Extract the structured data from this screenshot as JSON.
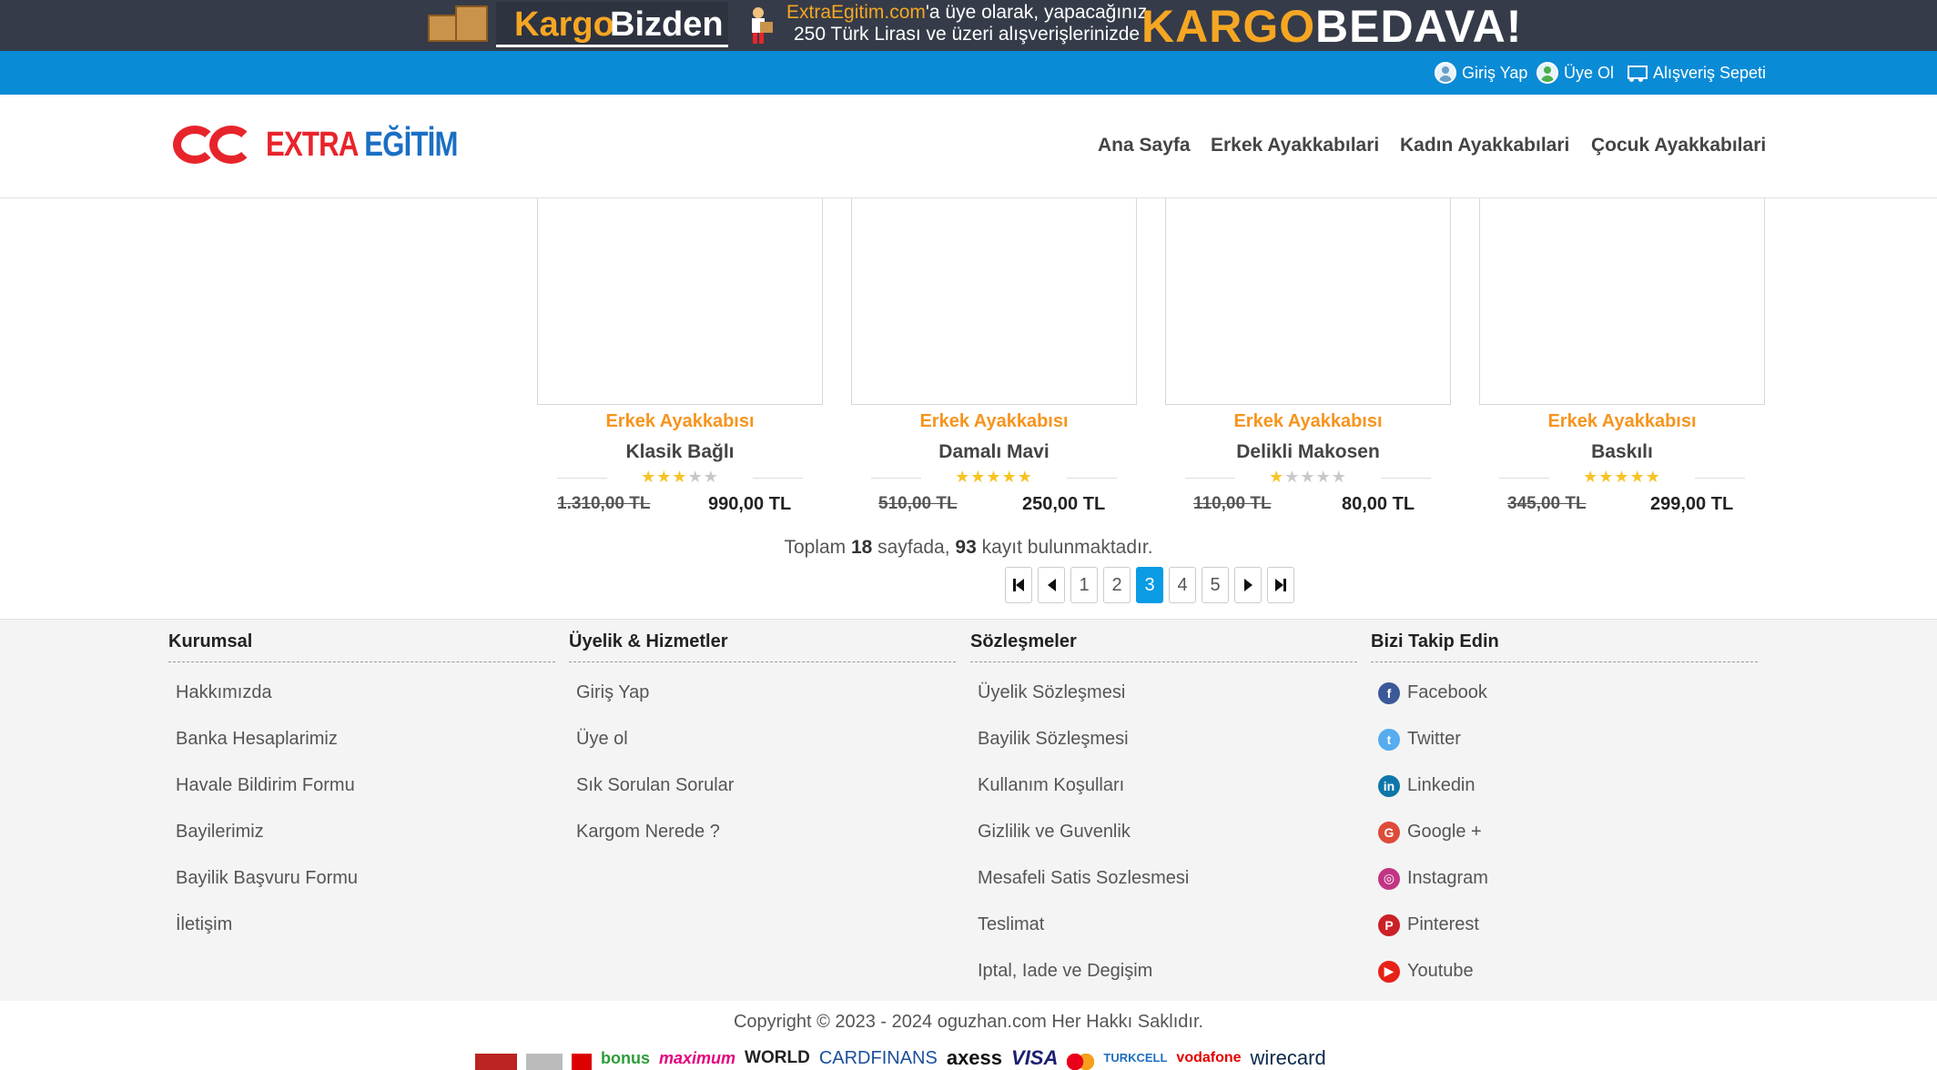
{
  "banner": {
    "brand_kargo": "Kargo",
    "brand_bizden": "Bizden",
    "line1_site": "ExtraEgitim.com",
    "line1_rest": "'a üye olarak, yapacağınız",
    "line2": "250 Türk Lirası ve üzeri alışverişlerinizde",
    "big1": "KARGO",
    "big2": "BEDAVA!"
  },
  "topbar": {
    "login": "Giriş Yap",
    "register": "Üye Ol",
    "cart": "Alışveriş Sepeti"
  },
  "header": {
    "logo_text_1": "EXTRA ",
    "logo_text_2": "EĞİTİM",
    "nav": [
      "Ana Sayfa",
      "Erkek Ayakkabılari",
      "Kadın Ayakkabılari",
      "Çocuk Ayakkabılari"
    ]
  },
  "products": [
    {
      "category": "Erkek Ayakkabısı",
      "name": "Klasik Bağlı",
      "rating": 3,
      "old_price": "1.310,00 TL",
      "price": "990,00 TL"
    },
    {
      "category": "Erkek Ayakkabısı",
      "name": "Damalı Mavi",
      "rating": 5,
      "old_price": "510,00 TL",
      "price": "250,00 TL"
    },
    {
      "category": "Erkek Ayakkabısı",
      "name": "Delikli Makosen",
      "rating": 1,
      "old_price": "110,00 TL",
      "price": "80,00 TL"
    },
    {
      "category": "Erkek Ayakkabısı",
      "name": "Baskılı",
      "rating": 5,
      "old_price": "345,00 TL",
      "price": "299,00 TL"
    }
  ],
  "paging": {
    "total_prefix": "Toplam ",
    "total_pages": "18",
    "total_mid": " sayfada, ",
    "total_records": "93",
    "total_suffix": " kayıt bulunmaktadır.",
    "pages": [
      "1",
      "2",
      "3",
      "4",
      "5"
    ],
    "active_page": "3"
  },
  "footer": {
    "columns": [
      {
        "title": "Kurumsal",
        "items": [
          "Hakkımızda",
          "Banka Hesaplarimiz",
          "Havale Bildirim Formu",
          "Bayilerimiz",
          "Bayilik Başvuru Formu",
          "İletişim"
        ]
      },
      {
        "title": "Üyelik & Hizmetler",
        "items": [
          "Giriş Yap",
          "Üye ol",
          "Sık Sorulan Sorular",
          "Kargom Nerede ?"
        ]
      },
      {
        "title": "Sözleşmeler",
        "items": [
          "Üyelik Sözleşmesi",
          "Bayilik Sözleşmesi",
          "Kullanım Koşulları",
          "Gizlilik ve Guvenlik",
          "Mesafeli Satis Sozlesmesi",
          "Teslimat",
          "Iptal, Iade ve Degişim"
        ]
      },
      {
        "title": "Bizi Takip Edin",
        "items": [
          "Facebook",
          "Twitter",
          "Linkedin",
          "Google +",
          "Instagram",
          "Pinterest",
          "Youtube"
        ]
      }
    ],
    "social_colors": [
      "#3b5998",
      "#55acee",
      "#0e76a8",
      "#dd4b39",
      "#c13584",
      "#cb2027",
      "#e62117"
    ],
    "copyright": "Copyright © 2023 - 2024 oguzhan.com Her Hakkı Saklıdır.",
    "payments": [
      "bonus",
      "maximum",
      "WORLD",
      "CARDFINANS",
      "axess",
      "VISA",
      "TURKCELL",
      "vodafone",
      "wirecard"
    ]
  }
}
